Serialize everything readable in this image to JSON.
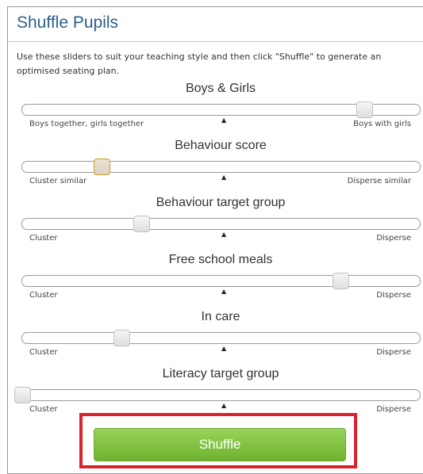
{
  "title": "Shuffle Pupils",
  "intro": "Use these sliders to suit your teaching style and then click \"Shuffle\" to generate an optimised seating plan.",
  "sliders": [
    {
      "label": "Boys & Girls",
      "min_text": "Boys together, girls together",
      "max_text": "Boys with girls",
      "value": 0.86,
      "mid_marker": "▲"
    },
    {
      "label": "Behaviour score",
      "min_text": "Cluster similar",
      "max_text": "Disperse similar",
      "value": 0.2,
      "mid_marker": "▲"
    },
    {
      "label": "Behaviour target group",
      "min_text": "Cluster",
      "max_text": "Disperse",
      "value": 0.3,
      "mid_marker": "▲"
    },
    {
      "label": "Free school meals",
      "min_text": "Cluster",
      "max_text": "Disperse",
      "value": 0.8,
      "mid_marker": "▲"
    },
    {
      "label": "In care",
      "min_text": "Cluster",
      "max_text": "Disperse",
      "value": 0.25,
      "mid_marker": "▲"
    },
    {
      "label": "Literacy target group",
      "min_text": "Cluster",
      "max_text": "Disperse",
      "value": 0.0,
      "mid_marker": "▲"
    }
  ],
  "shuffle_label": "Shuffle",
  "colors": {
    "title": "#2b5f8a",
    "button": "#7dbf3e",
    "highlight": "#d9232b"
  }
}
